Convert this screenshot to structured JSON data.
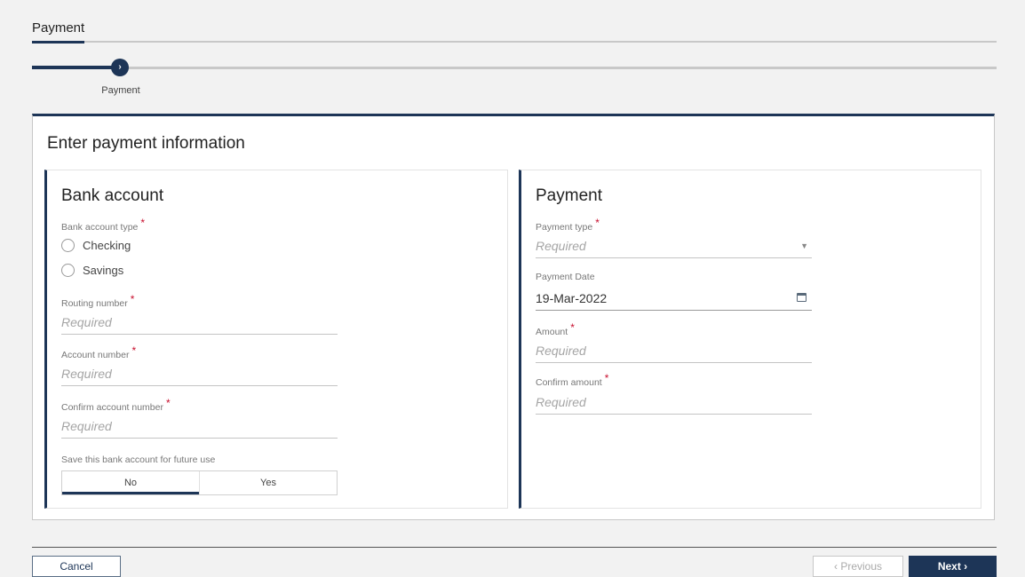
{
  "tabs": {
    "active": "Payment"
  },
  "stepper": {
    "step_label": "Payment",
    "node_glyph": "›"
  },
  "card": {
    "title": "Enter payment information"
  },
  "bank": {
    "title": "Bank account",
    "account_type_label": "Bank account type",
    "options": [
      "Checking",
      "Savings"
    ],
    "routing_label": "Routing number",
    "routing_placeholder": "Required",
    "account_label": "Account number",
    "account_placeholder": "Required",
    "confirm_account_label": "Confirm account number",
    "confirm_account_placeholder": "Required",
    "save_label": "Save this bank account for future use",
    "save_options": [
      "No",
      "Yes"
    ],
    "save_selected": "No"
  },
  "payment": {
    "title": "Payment",
    "type_label": "Payment type",
    "type_value": "Required",
    "date_label": "Payment Date",
    "date_value": "19-Mar-2022",
    "amount_label": "Amount",
    "amount_placeholder": "Required",
    "confirm_amount_label": "Confirm amount",
    "confirm_amount_placeholder": "Required"
  },
  "required_marker": "*",
  "footer": {
    "cancel": "Cancel",
    "previous": "‹  Previous",
    "next": "Next   ›"
  },
  "colors": {
    "accent": "#1d3557",
    "required": "#c8102e"
  }
}
